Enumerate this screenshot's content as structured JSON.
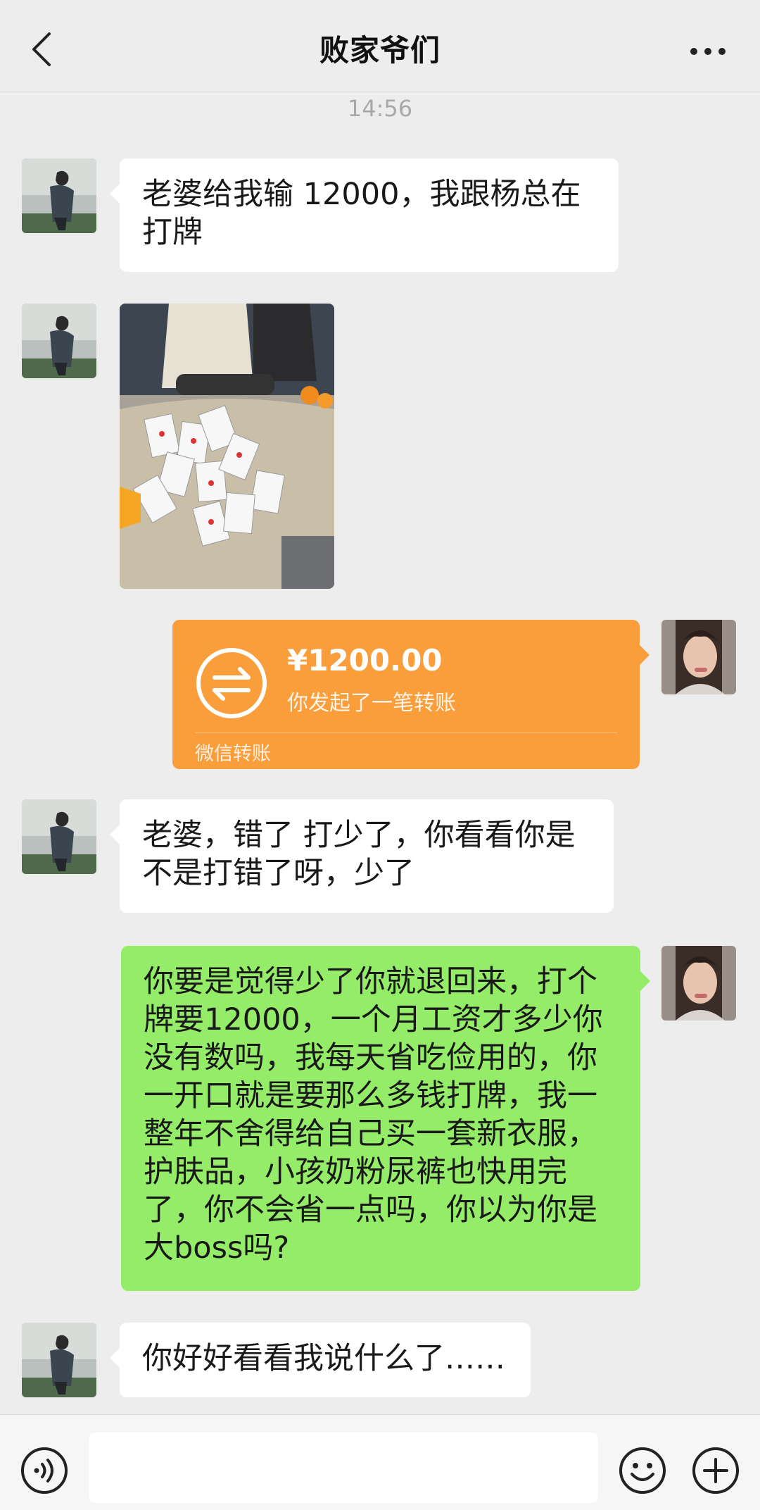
{
  "header": {
    "title": "败家爷们",
    "back_icon": "chevron-left-icon",
    "more_icon": "ellipsis-icon"
  },
  "timestamp": "14:56",
  "messages": [
    {
      "side": "left",
      "type": "text",
      "text": "老婆给我输 12000，我跟杨总在打牌"
    },
    {
      "side": "left",
      "type": "image",
      "content": "photo of people playing cards on a table"
    },
    {
      "side": "right",
      "type": "transfer",
      "amount": "¥1200.00",
      "description": "你发起了一笔转账",
      "label": "微信转账"
    },
    {
      "side": "left",
      "type": "text",
      "text": "老婆，错了 打少了，你看看你是不是打错了呀，少了"
    },
    {
      "side": "right",
      "type": "text",
      "text": "你要是觉得少了你就退回来，打个牌要12000，一个月工资才多少你没有数吗，我每天省吃俭用的，你一开口就是要那么多钱打牌，我一整年不舍得给自己买一套新衣服，护肤品，小孩奶粉尿裤也快用完了，你不会省一点吗，你以为你是大boss吗?"
    },
    {
      "side": "left",
      "type": "text",
      "text": "你好好看看我说什么了……"
    }
  ],
  "input_bar": {
    "voice_icon": "voice-icon",
    "input_value": "",
    "emoji_icon": "emoji-icon",
    "plus_icon": "plus-circle-icon"
  },
  "colors": {
    "background": "#ededed",
    "bubble_self": "#95ec69",
    "bubble_other": "#ffffff",
    "transfer": "#fa9d3b"
  }
}
